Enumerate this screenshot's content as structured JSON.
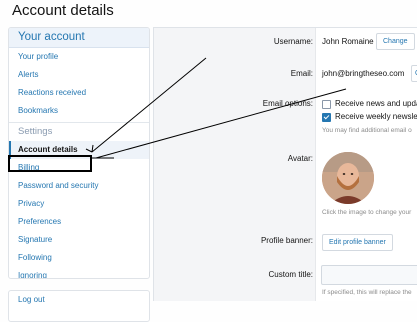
{
  "page": {
    "title": "Account details"
  },
  "sidebar": {
    "header": "Your account",
    "items_top": [
      {
        "label": "Your profile"
      },
      {
        "label": "Alerts"
      },
      {
        "label": "Reactions received"
      },
      {
        "label": "Bookmarks"
      }
    ],
    "settings_header": "Settings",
    "items_settings": [
      {
        "label": "Account details",
        "active": true
      },
      {
        "label": "Billing"
      },
      {
        "label": "Password and security"
      },
      {
        "label": "Privacy"
      },
      {
        "label": "Preferences"
      },
      {
        "label": "Signature"
      },
      {
        "label": "Following"
      },
      {
        "label": "Ignoring"
      }
    ],
    "logout": "Log out"
  },
  "main": {
    "username_label": "Username:",
    "username_value": "John Romaine",
    "change_button": "Change",
    "email_label": "Email:",
    "email_value": "john@bringtheseo.com",
    "email_change_button_partial": "C",
    "email_options_label": "Email options:",
    "option_news": "Receive news and upda",
    "option_weekly": "Receive weekly newslet",
    "option_hint": "You may find additional email o",
    "avatar_label": "Avatar:",
    "avatar_hint": "Click the image to change your",
    "banner_label": "Profile banner:",
    "edit_banner_button": "Edit profile banner",
    "custom_title_label": "Custom title:",
    "custom_title_hint": "If specified, this will replace the"
  },
  "annotation": {
    "color": "#000000"
  }
}
